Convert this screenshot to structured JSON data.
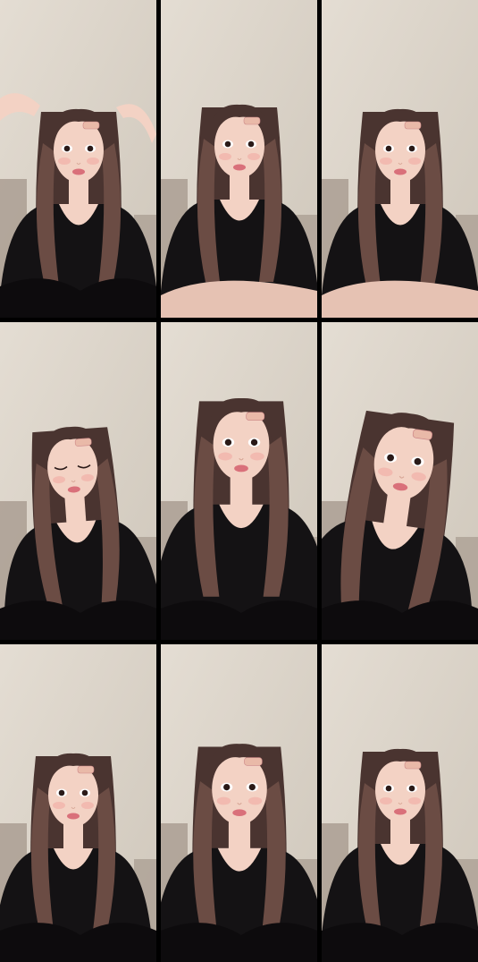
{
  "grid": {
    "rows": 3,
    "columns": 3
  },
  "colors": {
    "wall": "#ddd6cc",
    "wall_shadow": "#cfc7bb",
    "hair": "#4a3430",
    "hair_highlight": "#6b4c44",
    "skin": "#f3d2c4",
    "cheek": "#f0a5a0",
    "lips": "#d9707a",
    "clothing": "#141214",
    "sofa": "#a79a8f",
    "clip": "#e9b9a8"
  },
  "frames": [
    {
      "id": 1,
      "eyes": "open",
      "hands_raised": true,
      "knee": false
    },
    {
      "id": 2,
      "eyes": "open",
      "hands_raised": false,
      "knee": true
    },
    {
      "id": 3,
      "eyes": "open",
      "hands_raised": false,
      "knee": true
    },
    {
      "id": 4,
      "eyes": "closed",
      "hands_raised": false,
      "knee": false
    },
    {
      "id": 5,
      "eyes": "open",
      "hands_raised": false,
      "knee": false
    },
    {
      "id": 6,
      "eyes": "open",
      "hands_raised": false,
      "knee": false
    },
    {
      "id": 7,
      "eyes": "open",
      "hands_raised": false,
      "knee": false
    },
    {
      "id": 8,
      "eyes": "open",
      "hands_raised": false,
      "knee": false
    },
    {
      "id": 9,
      "eyes": "open",
      "hands_raised": false,
      "knee": false
    }
  ]
}
